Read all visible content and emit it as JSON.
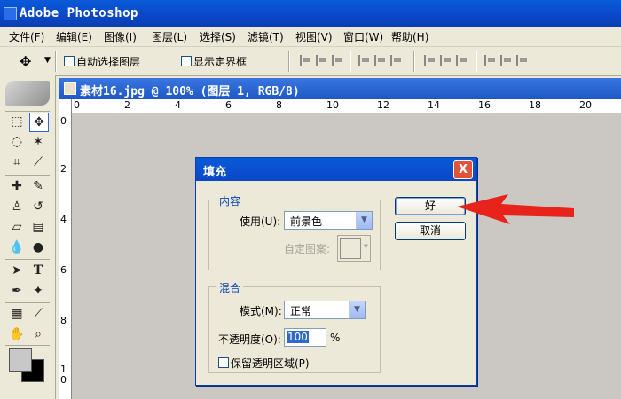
{
  "app": {
    "title": "Adobe Photoshop"
  },
  "menu": [
    "文件(F)",
    "编辑(E)",
    "图像(I)",
    "图层(L)",
    "选择(S)",
    "滤镜(T)",
    "视图(V)",
    "窗口(W)",
    "帮助(H)"
  ],
  "options": {
    "auto_select": "自动选择图层",
    "show_bounds": "显示定界框"
  },
  "document": {
    "title": "素材16.jpg @ 100% (图层 1, RGB/8)"
  },
  "ruler_h": [
    "0",
    "2",
    "4",
    "6",
    "8",
    "10",
    "12",
    "14",
    "16",
    "18",
    "20"
  ],
  "ruler_v": [
    "0",
    "2",
    "4",
    "6",
    "8",
    "1",
    "0"
  ],
  "dialog": {
    "title": "填充",
    "close": "X",
    "content_group": "内容",
    "use_label": "使用(U):",
    "use_value": "前景色",
    "pattern_label": "自定图案:",
    "blend_group": "混合",
    "mode_label": "模式(M):",
    "mode_value": "正常",
    "opacity_label": "不透明度(O):",
    "opacity_value": "100",
    "opacity_unit": "%",
    "preserve_label": "保留透明区域(P)",
    "ok": "好",
    "cancel": "取消"
  },
  "colors": {
    "titlebar": "#0b47c7",
    "canvas": "#cbc7c2",
    "arrow": "#e8231c",
    "foreground": "#c8c8c8",
    "background": "#000000"
  },
  "icons": [
    "move-icon",
    "marquee-icon",
    "lasso-icon",
    "magic-wand-icon",
    "crop-icon",
    "slice-icon",
    "healing-brush-icon",
    "brush-icon",
    "clone-stamp-icon",
    "history-brush-icon",
    "eraser-icon",
    "gradient-icon",
    "blur-icon",
    "dodge-icon",
    "path-select-icon",
    "type-icon",
    "pen-icon",
    "shape-icon",
    "notes-icon",
    "eyedropper-icon",
    "hand-icon",
    "zoom-icon"
  ]
}
